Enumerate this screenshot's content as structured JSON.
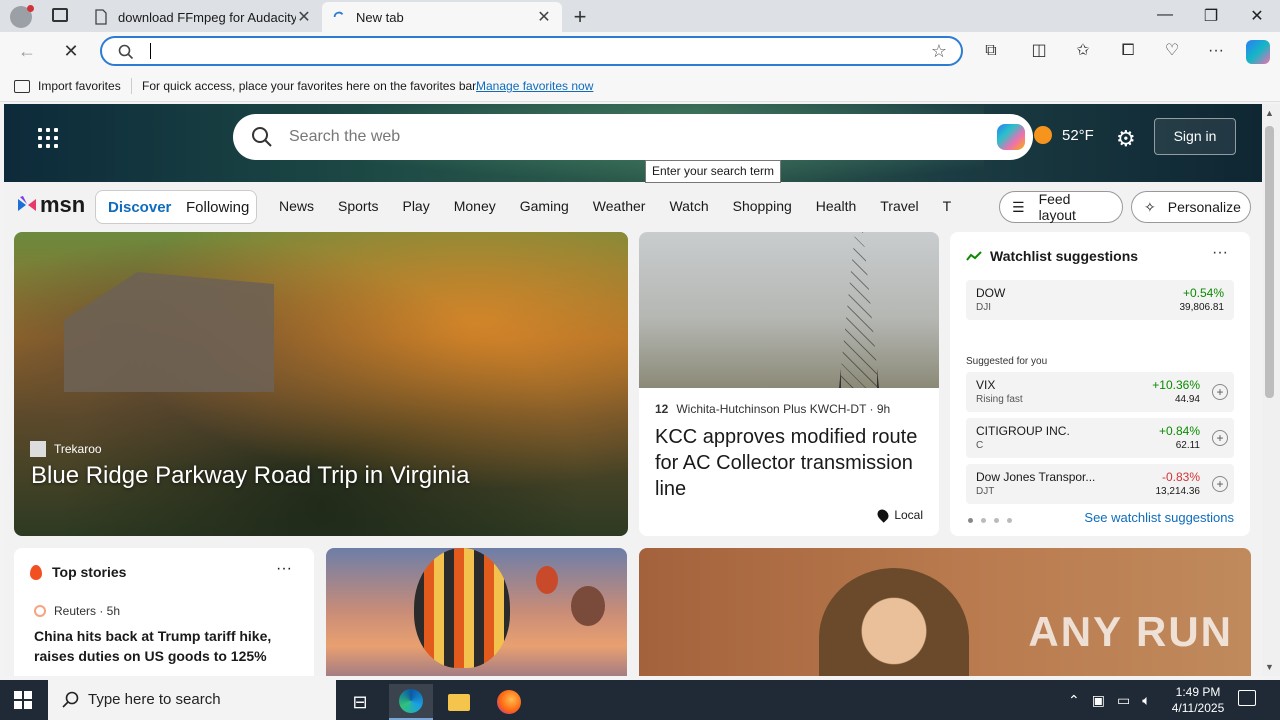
{
  "browser": {
    "tabs": [
      {
        "label": "download FFmpeg for Audacity -"
      },
      {
        "label": "New tab"
      }
    ],
    "address": {
      "value": "",
      "placeholder": ""
    },
    "favorites_bar": {
      "import_label": "Import favorites",
      "message": "For quick access, place your favorites here on the favorites bar.",
      "link": "Manage favorites now"
    }
  },
  "msn": {
    "search_placeholder": "Search the web",
    "tooltip": "Enter your search term",
    "weather": "52°F",
    "sign_in": "Sign in",
    "logo": "msn",
    "feed_tabs": [
      "Discover",
      "Following"
    ],
    "categories": [
      "News",
      "Sports",
      "Play",
      "Money",
      "Gaming",
      "Weather",
      "Watch",
      "Shopping",
      "Health",
      "Travel",
      "Trai"
    ],
    "feed_layout": "Feed layout",
    "personalize": "Personalize",
    "hero": {
      "source": "Trekaroo",
      "title": "Blue Ridge Parkway Road Trip in Virginia"
    },
    "news": {
      "source": "Wichita-Hutchinson Plus KWCH-DT · 9h",
      "source_badge": "12",
      "title": "KCC approves modified route for AC Collector transmission line",
      "tag": "Local"
    },
    "watchlist": {
      "title": "Watchlist suggestions",
      "more": "···",
      "suggested_label": "Suggested for you",
      "see_all": "See watchlist suggestions",
      "stocks": [
        {
          "name": "DOW",
          "ticker": "DJI",
          "change": "+0.54%",
          "price": "39,806.81",
          "dir": "up"
        },
        {
          "name": "VIX",
          "ticker": "Rising fast",
          "change": "+10.36%",
          "price": "44.94",
          "dir": "up"
        },
        {
          "name": "CITIGROUP INC.",
          "ticker": "C",
          "change": "+0.84%",
          "price": "62.11",
          "dir": "up"
        },
        {
          "name": "Dow Jones Transpor...",
          "ticker": "DJT",
          "change": "-0.83%",
          "price": "13,214.36",
          "dir": "down"
        }
      ]
    },
    "top_stories": {
      "title": "Top stories",
      "more": "···",
      "source": "Reuters · 5h",
      "headline": "China hits back at Trump tariff hike, raises duties on US goods to 125%"
    },
    "watermark": "ANY RUN"
  },
  "taskbar": {
    "search_placeholder": "Type here to search",
    "time": "1:49 PM",
    "date": "4/11/2025"
  }
}
